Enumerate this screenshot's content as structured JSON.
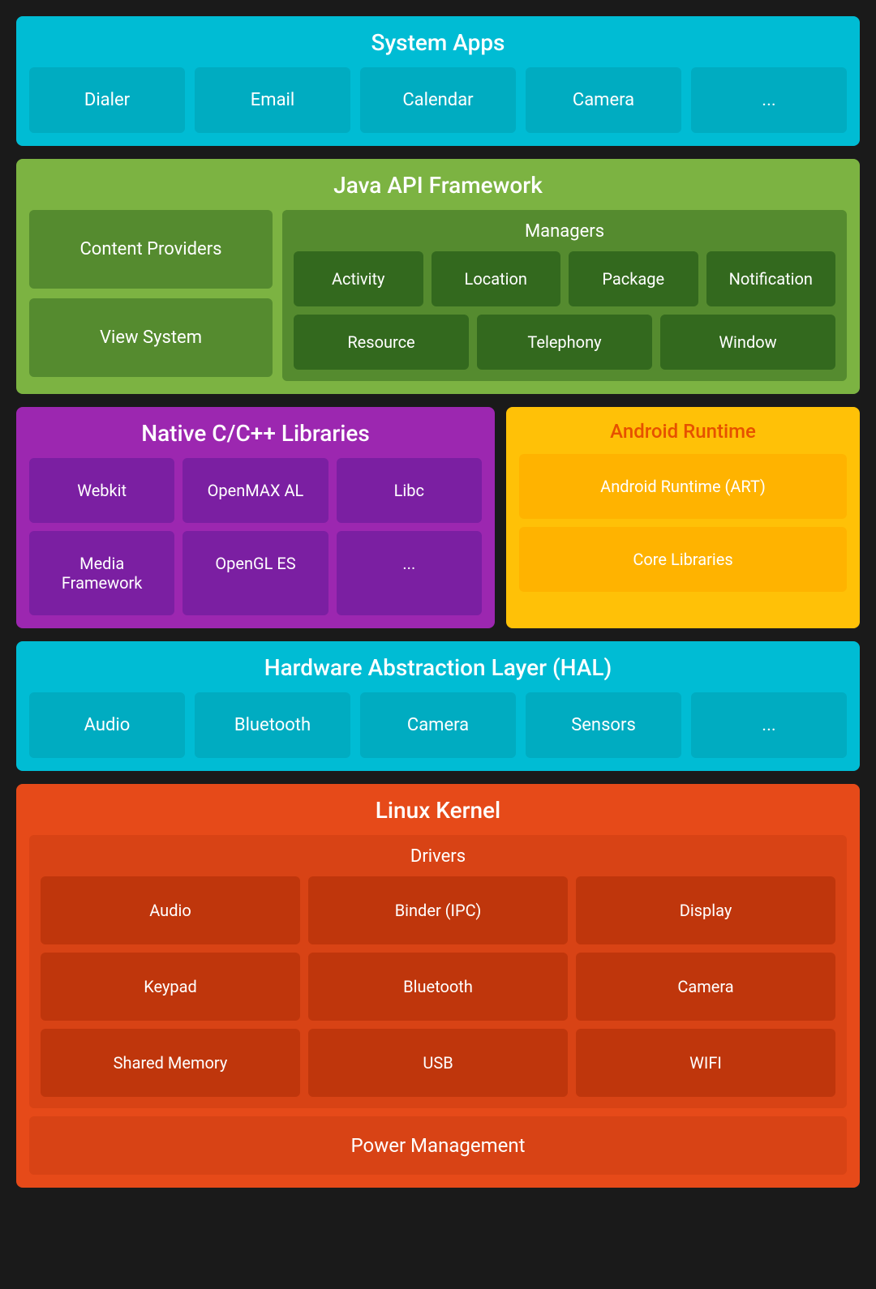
{
  "systemApps": {
    "title": "System Apps",
    "apps": [
      "Dialer",
      "Email",
      "Calendar",
      "Camera",
      "..."
    ]
  },
  "javaApi": {
    "title": "Java API Framework",
    "leftItems": [
      "Content Providers",
      "View System"
    ],
    "managers": {
      "title": "Managers",
      "row1": [
        "Activity",
        "Location",
        "Package",
        "Notification"
      ],
      "row2": [
        "Resource",
        "Telephony",
        "Window"
      ]
    }
  },
  "nativeCpp": {
    "title": "Native C/C++ Libraries",
    "row1": [
      "Webkit",
      "OpenMAX AL",
      "Libc"
    ],
    "row2": [
      "Media Framework",
      "OpenGL ES",
      "..."
    ]
  },
  "androidRuntime": {
    "title": "Android Runtime",
    "items": [
      "Android Runtime (ART)",
      "Core Libraries"
    ]
  },
  "hal": {
    "title": "Hardware Abstraction Layer (HAL)",
    "items": [
      "Audio",
      "Bluetooth",
      "Camera",
      "Sensors",
      "..."
    ]
  },
  "linuxKernel": {
    "title": "Linux Kernel",
    "drivers": {
      "title": "Drivers",
      "row1": [
        "Audio",
        "Binder (IPC)",
        "Display"
      ],
      "row2": [
        "Keypad",
        "Bluetooth",
        "Camera"
      ],
      "row3": [
        "Shared Memory",
        "USB",
        "WIFI"
      ]
    },
    "powerManagement": "Power Management"
  }
}
